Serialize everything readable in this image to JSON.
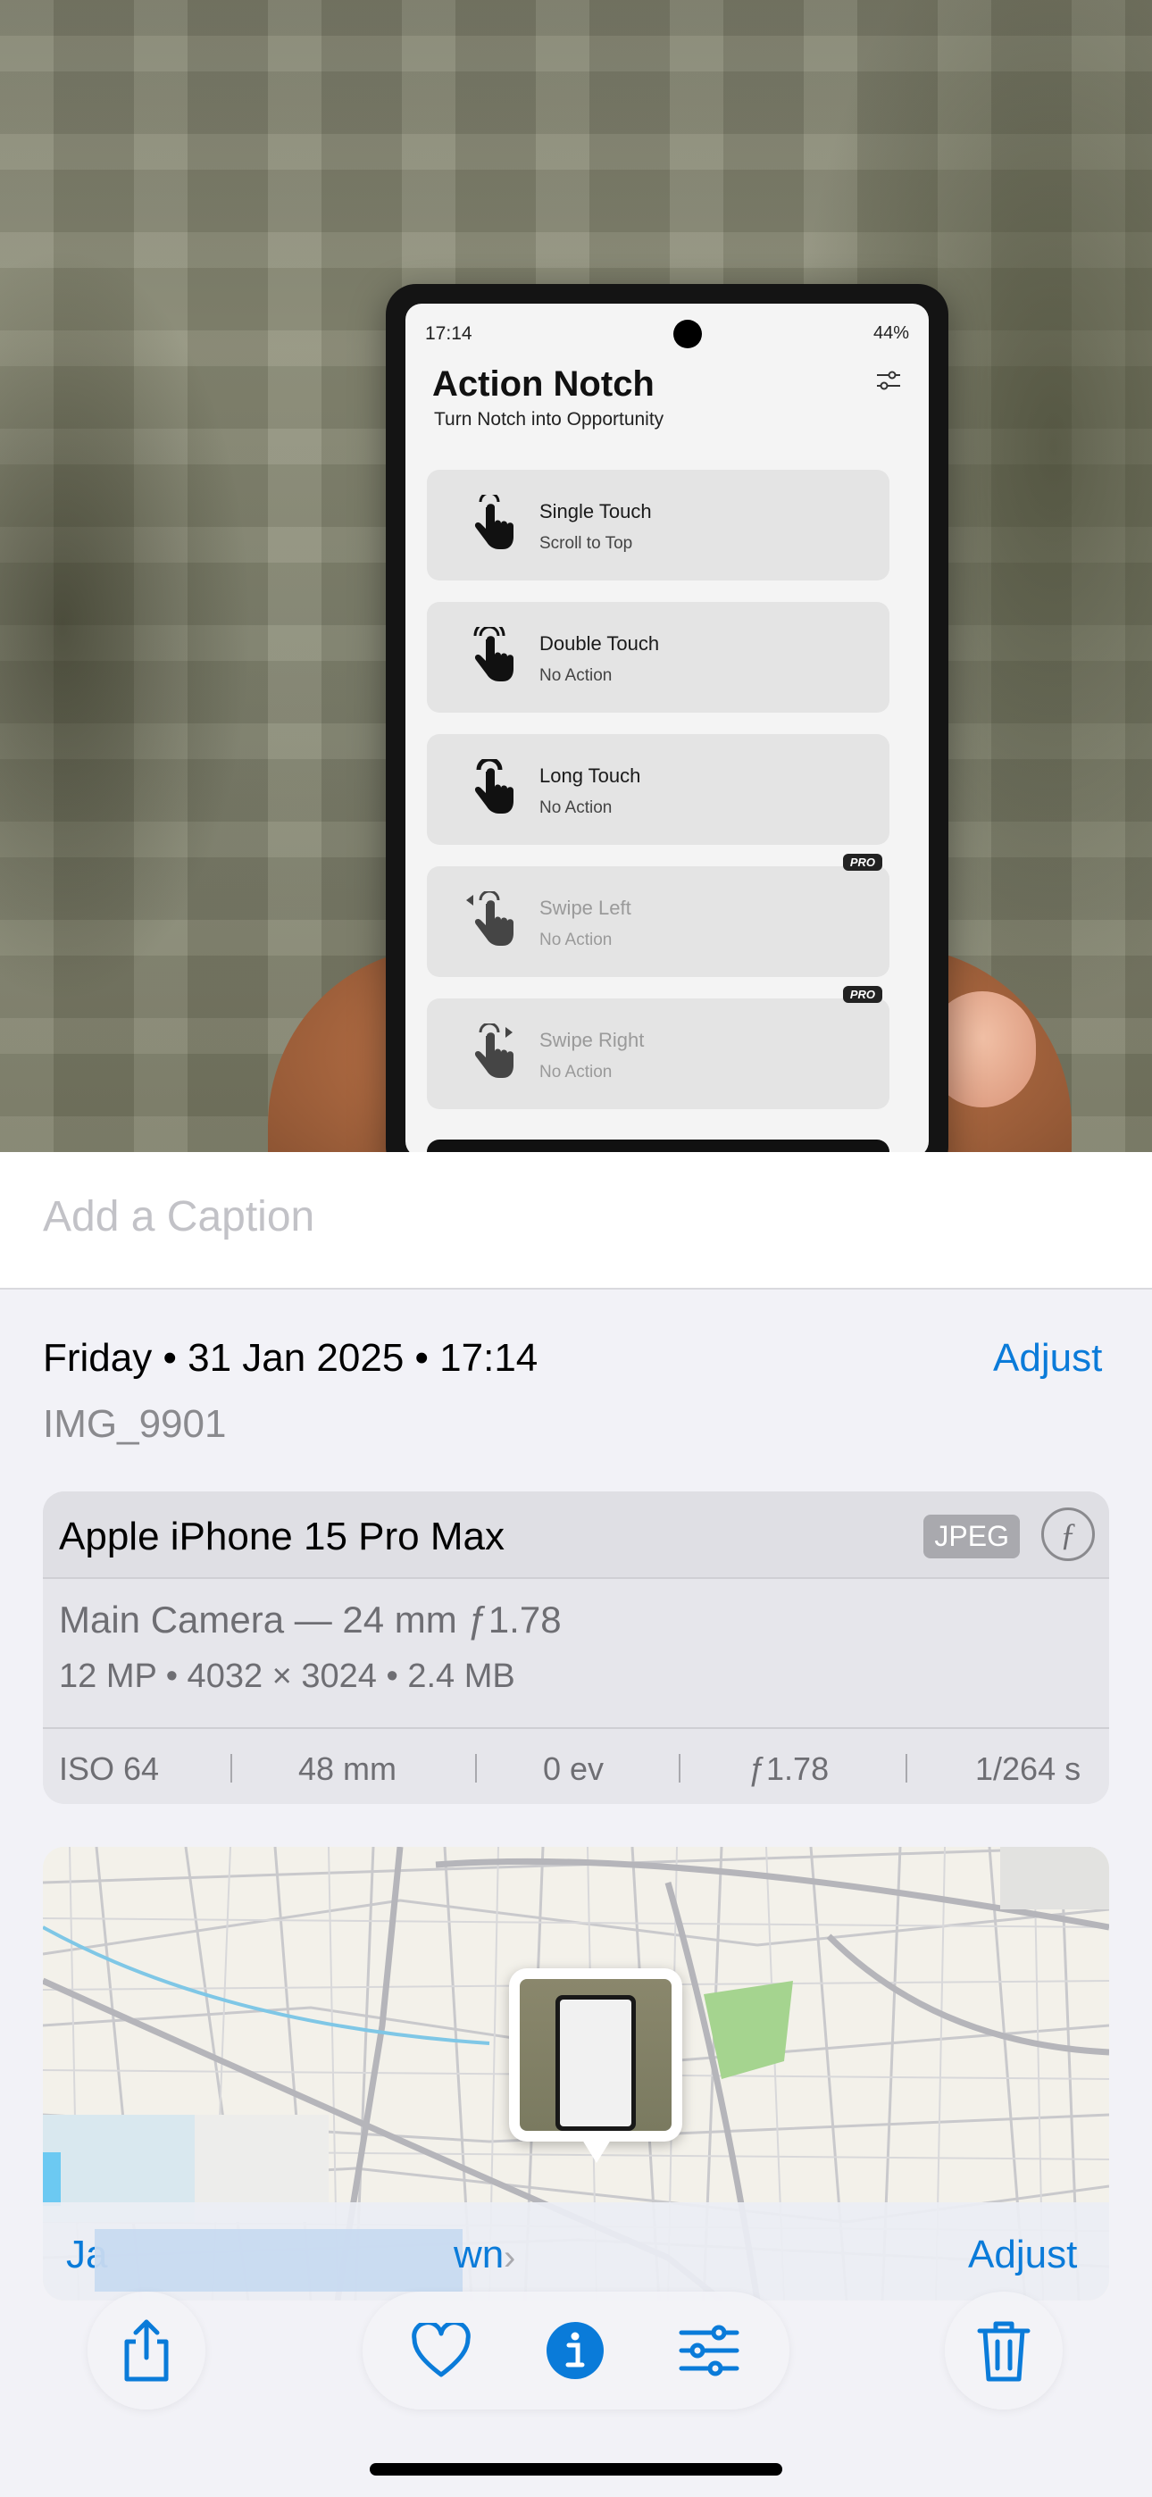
{
  "photo": {
    "phone_screen": {
      "status_time": "17:14",
      "status_right": "44%",
      "app_title": "Action Notch",
      "app_subtitle": "Turn Notch into Opportunity",
      "pro_badge": "PRO",
      "actions": [
        {
          "title": "Single Touch",
          "subtitle": "Scroll to Top"
        },
        {
          "title": "Double Touch",
          "subtitle": "No Action"
        },
        {
          "title": "Long Touch",
          "subtitle": "No Action"
        },
        {
          "title": "Swipe Left",
          "subtitle": "No Action"
        },
        {
          "title": "Swipe Right",
          "subtitle": "No Action"
        }
      ]
    }
  },
  "caption": {
    "placeholder": "Add a Caption"
  },
  "info": {
    "datetime": "Friday • 31 Jan 2025 • 17:14",
    "adjust_label": "Adjust",
    "filename": "IMG_9901"
  },
  "device": {
    "name": "Apple iPhone 15 Pro Max",
    "format_badge": "JPEG",
    "f_badge": "ƒ",
    "lens": "Main Camera — 24 mm ƒ1.78",
    "specs": "12 MP • 4032 × 3024 • 2.4 MB",
    "exif": [
      "ISO 64",
      "48 mm",
      "0 ev",
      "ƒ1.78",
      "1/264 s"
    ]
  },
  "map": {
    "location_visible_start": "Ja",
    "location_visible_end": "wn",
    "adjust_label": "Adjust"
  },
  "toolbar": {
    "icons": [
      "share-icon",
      "heart-icon",
      "info-icon",
      "adjustments-icon",
      "trash-icon"
    ],
    "accent": "#0a7bd9"
  }
}
